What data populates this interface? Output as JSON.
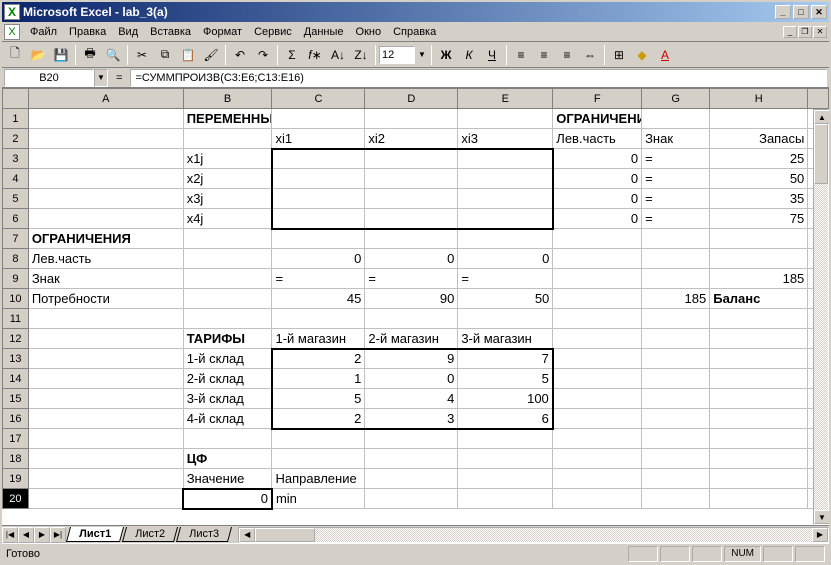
{
  "window": {
    "title": "Microsoft Excel - lab_3(a)"
  },
  "menu": [
    "Файл",
    "Правка",
    "Вид",
    "Вставка",
    "Формат",
    "Сервис",
    "Данные",
    "Окно",
    "Справка"
  ],
  "fontsize": "12",
  "formulabar": {
    "namebox": "B20",
    "eq": "=",
    "formula": "=СУММПРОИЗВ(C3:E6;C13:E16)"
  },
  "columns": [
    "A",
    "B",
    "C",
    "D",
    "E",
    "F",
    "G",
    "H"
  ],
  "sheet": {
    "r1": {
      "b": "ПЕРЕМЕННЫЕ",
      "f": "ОГРАНИЧЕНИЯ"
    },
    "r2": {
      "c": "xi1",
      "d": "xi2",
      "e": "xi3",
      "f": "Лев.часть",
      "g": "Знак",
      "h": "Запасы"
    },
    "r3": {
      "b": "x1j",
      "f": "0",
      "g": "=",
      "h": "25"
    },
    "r4": {
      "b": "x2j",
      "f": "0",
      "g": "=",
      "h": "50"
    },
    "r5": {
      "b": "x3j",
      "f": "0",
      "g": "=",
      "h": "35"
    },
    "r6": {
      "b": "x4j",
      "f": "0",
      "g": "=",
      "h": "75"
    },
    "r7": {
      "a": "ОГРАНИЧЕНИЯ"
    },
    "r8": {
      "a": "Лев.часть",
      "c": "0",
      "d": "0",
      "e": "0"
    },
    "r9": {
      "a": "Знак",
      "c": "=",
      "d": "=",
      "e": "=",
      "h": "185"
    },
    "r10": {
      "a": "Потребности",
      "c": "45",
      "d": "90",
      "e": "50",
      "g": "185",
      "h": "Баланс"
    },
    "r12": {
      "b": "ТАРИФЫ",
      "c": "1-й магазин",
      "d": "2-й магазин",
      "e": "3-й магазин"
    },
    "r13": {
      "b": "1-й склад",
      "c": "2",
      "d": "9",
      "e": "7"
    },
    "r14": {
      "b": "2-й склад",
      "c": "1",
      "d": "0",
      "e": "5"
    },
    "r15": {
      "b": "3-й склад",
      "c": "5",
      "d": "4",
      "e": "100"
    },
    "r16": {
      "b": "4-й склад",
      "c": "2",
      "d": "3",
      "e": "6"
    },
    "r18": {
      "b": "ЦФ"
    },
    "r19": {
      "b": "Значение",
      "c": "Направление"
    },
    "r20": {
      "b": "0",
      "c": "min"
    }
  },
  "tabs": [
    "Лист1",
    "Лист2",
    "Лист3"
  ],
  "statusbar": {
    "ready": "Готово",
    "num": "NUM"
  }
}
